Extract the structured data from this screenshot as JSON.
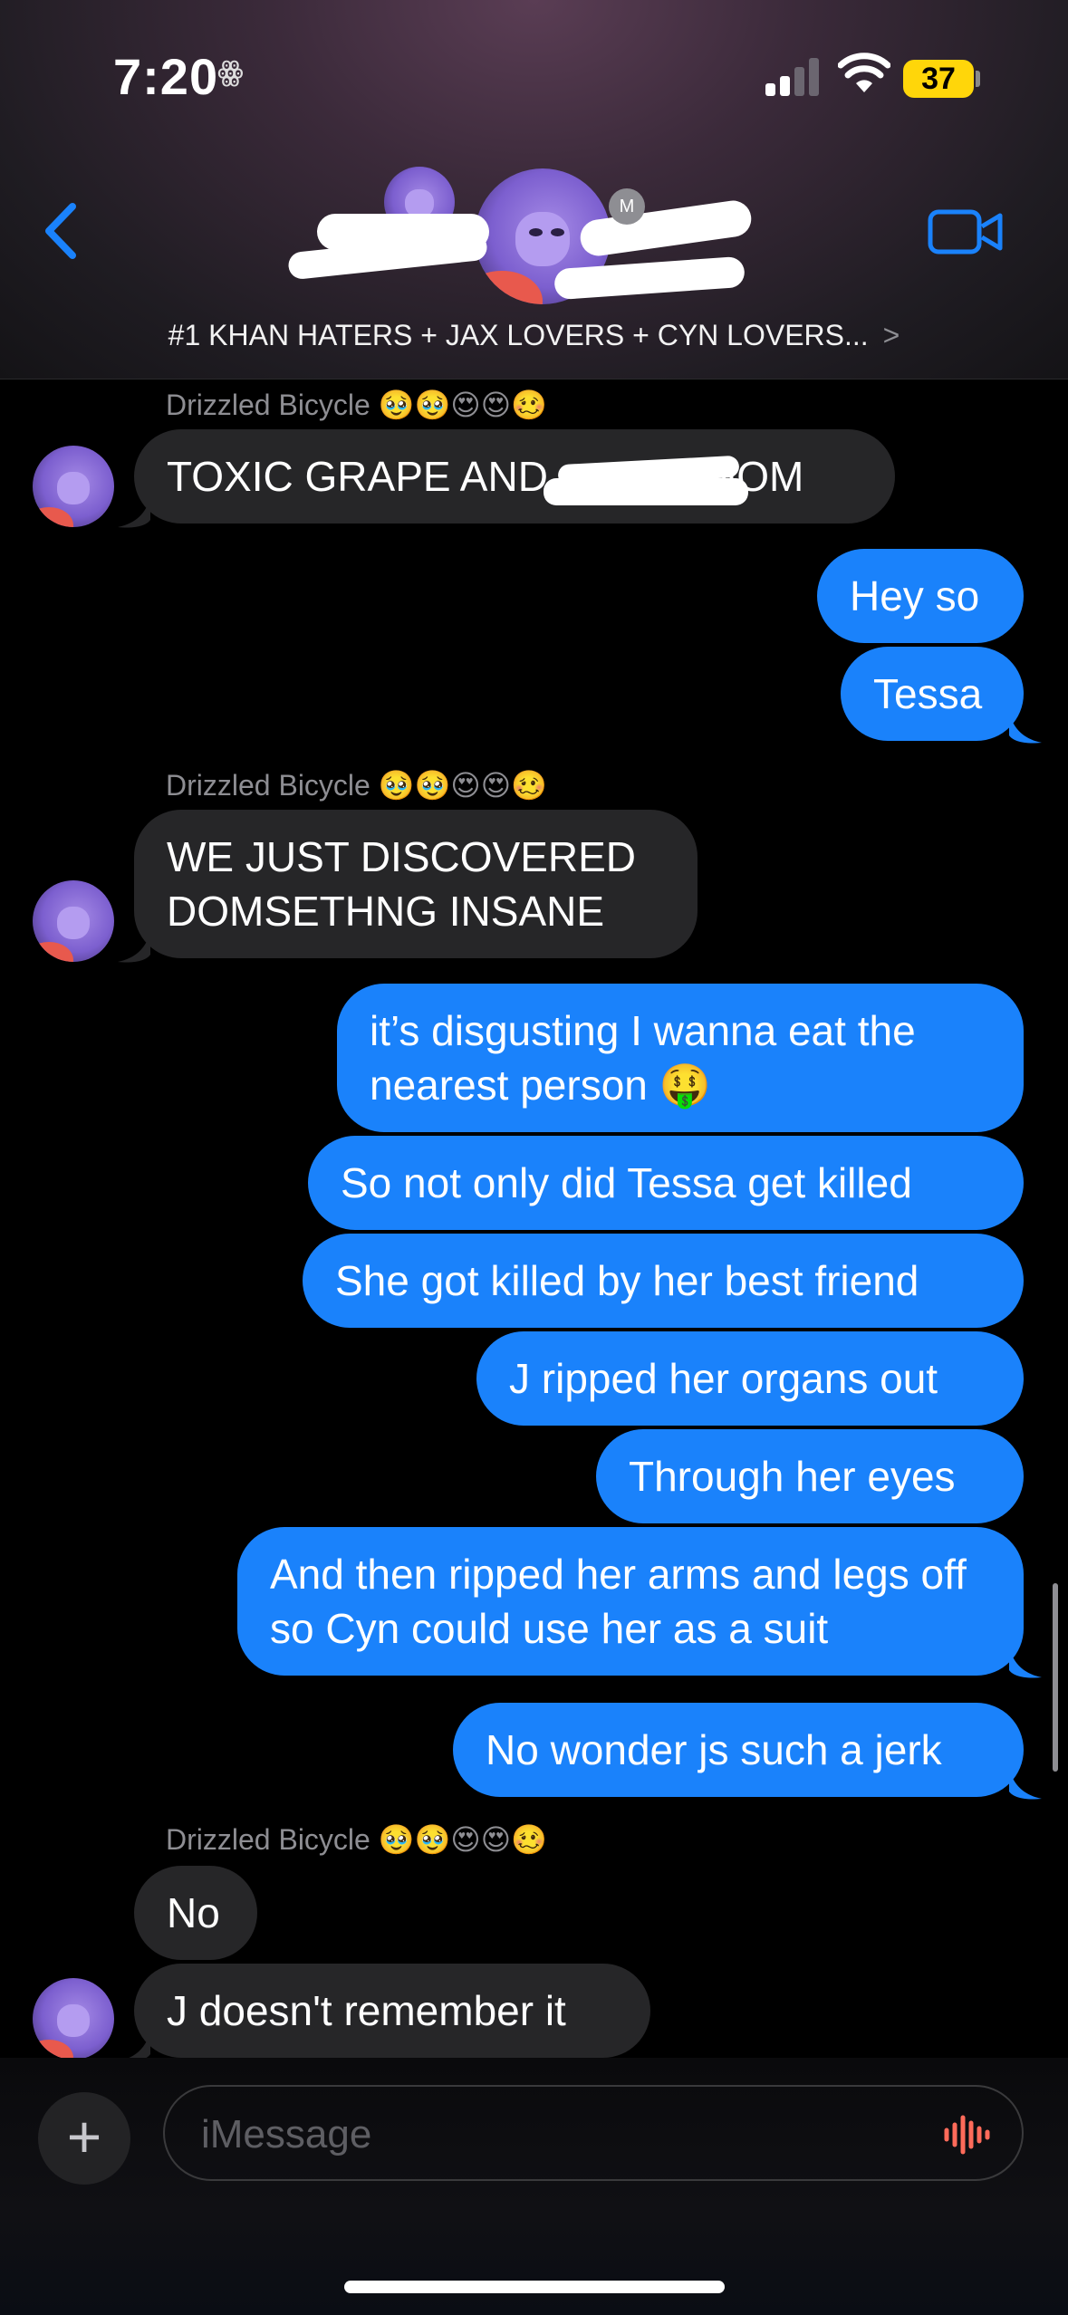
{
  "status": {
    "time": "7:20",
    "glyph": "ꙮ",
    "battery": "37"
  },
  "header": {
    "group_name": "#1 KHAN HATERS + JAX LOVERS + CYN LOVERS...",
    "chevron": ">",
    "member_initial": "M"
  },
  "messages": {
    "sender_name": "Drizzled Bicycle 🥹🥹😍😍🥴",
    "m1": "TOXIC GRAPE AND",
    "m1_tail": "MOM",
    "m2": "Hey so",
    "m3": "Tessa",
    "m4": "WE JUST DISCOVERED DOMSETHNG INSANE",
    "m5": "it’s disgusting I wanna eat the nearest person 🤑",
    "m6": "So not only did Tessa get killed",
    "m7": "She got killed by her best friend",
    "m8": "J ripped her organs out",
    "m9": "Through her eyes",
    "m10": "And then ripped her arms and legs off so Cyn could use her as a suit",
    "m11": "No wonder js such a jerk",
    "m12": "No",
    "m13": "J doesn't remember it"
  },
  "input": {
    "placeholder": "iMessage",
    "plus": "+"
  },
  "colors": {
    "outgoing": "#1a82fb",
    "incoming": "#262628",
    "accent": "#1a82fb"
  }
}
